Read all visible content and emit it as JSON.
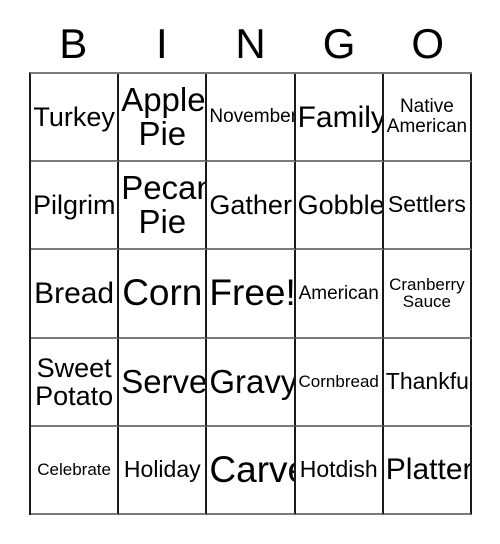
{
  "card": {
    "title_letters": [
      {
        "label": "B"
      },
      {
        "label": "I"
      },
      {
        "label": "N"
      },
      {
        "label": "G"
      },
      {
        "label": "O"
      }
    ],
    "free_space_label": "Free!",
    "columns": 5,
    "rows": 5,
    "border_color": "#1a1a1a",
    "background_color": "#ffffff",
    "text_color": "#000000",
    "cells": [
      {
        "text": "Turkey",
        "size": "md",
        "lines": 1
      },
      {
        "text": "Apple\nPie",
        "size": "xl",
        "lines": 2
      },
      {
        "text": "November",
        "size": "xs",
        "lines": 1
      },
      {
        "text": "Family",
        "size": "lg",
        "lines": 1
      },
      {
        "text": "Native\nAmerican",
        "size": "xs",
        "lines": 2
      },
      {
        "text": "Pilgrim",
        "size": "md",
        "lines": 1
      },
      {
        "text": "Pecan\nPie",
        "size": "xl",
        "lines": 2
      },
      {
        "text": "Gather",
        "size": "md",
        "lines": 1
      },
      {
        "text": "Gobble",
        "size": "md",
        "lines": 1
      },
      {
        "text": "Settlers",
        "size": "sm",
        "lines": 1
      },
      {
        "text": "Bread",
        "size": "lg",
        "lines": 1
      },
      {
        "text": "Corn",
        "size": "xxl",
        "lines": 1
      },
      {
        "text": "Free!",
        "size": "xxl",
        "lines": 1
      },
      {
        "text": "American",
        "size": "xs",
        "lines": 1
      },
      {
        "text": "Cranberry\nSauce",
        "size": "xxs",
        "lines": 2
      },
      {
        "text": "Sweet\nPotato",
        "size": "md",
        "lines": 2
      },
      {
        "text": "Serve",
        "size": "xl",
        "lines": 1
      },
      {
        "text": "Gravy",
        "size": "xl",
        "lines": 1
      },
      {
        "text": "Cornbread",
        "size": "xxs",
        "lines": 1
      },
      {
        "text": "Thankful",
        "size": "sm",
        "lines": 1
      },
      {
        "text": "Celebrate",
        "size": "xxs",
        "lines": 1
      },
      {
        "text": "Holiday",
        "size": "sm",
        "lines": 1
      },
      {
        "text": "Carve",
        "size": "xxl",
        "lines": 1
      },
      {
        "text": "Hotdish",
        "size": "sm",
        "lines": 1
      },
      {
        "text": "Platter",
        "size": "lg",
        "lines": 1
      }
    ]
  }
}
